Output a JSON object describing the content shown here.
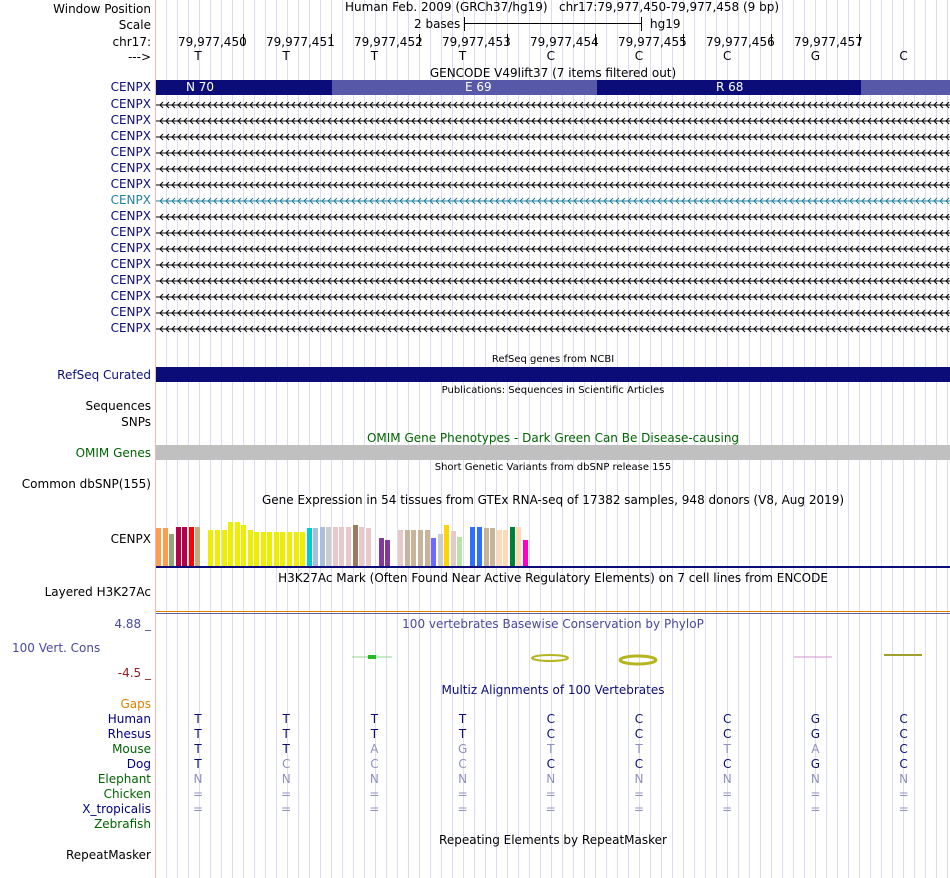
{
  "header": {
    "window_position_label": "Window Position",
    "scale_label": "Scale",
    "chrom_label": "chr17:",
    "strand_label": "--->",
    "assembly": "Human Feb. 2009 (GRCh37/hg19)",
    "position": "chr17:79,977,450-79,977,458 (9 bp)",
    "scale_text": "2 bases",
    "scale_db": "hg19"
  },
  "ruler": {
    "coords": [
      "79,977,450",
      "79,977,451",
      "79,977,452",
      "79,977,453",
      "79,977,454",
      "79,977,455",
      "79,977,456",
      "79,977,457"
    ],
    "bases": [
      "T",
      "T",
      "T",
      "T",
      "C",
      "C",
      "C",
      "G",
      "C"
    ]
  },
  "gencode": {
    "title": "GENCODE V49lift37 (7 items filtered out)",
    "label": "CENPX",
    "aa": [
      "N 70",
      "E 69",
      "R 68"
    ],
    "rows": [
      "CENPX",
      "CENPX",
      "CENPX",
      "CENPX",
      "CENPX",
      "CENPX",
      "CENPX",
      "CENPX",
      "CENPX",
      "CENPX",
      "CENPX",
      "CENPX",
      "CENPX",
      "CENPX",
      "CENPX"
    ],
    "highlight_row": 6
  },
  "refseq": {
    "title": "RefSeq genes from NCBI",
    "label": "RefSeq Curated"
  },
  "publications": {
    "title": "Publications: Sequences in Scientific Articles",
    "label1": "Sequences",
    "label2": "SNPs"
  },
  "omim": {
    "title": "OMIM Gene Phenotypes - Dark Green Can Be Disease-causing",
    "label": "OMIM Genes"
  },
  "dbsnp": {
    "title": "Short Genetic Variants from dbSNP release 155",
    "label": "Common dbSNP(155)"
  },
  "gtex": {
    "title": "Gene Expression in 54 tissues from GTEx RNA-seq of 17382 samples, 948 donors (V8, Aug 2019)",
    "label": "CENPX",
    "colors": [
      "#ff9d4e",
      "#ff9d4e",
      "#94a57a",
      "#b5004a",
      "#b5004a",
      "#ff0000",
      "#c7a97a",
      "#ffffff",
      "#eeee00",
      "#eeee00",
      "#eeee00",
      "#eeee00",
      "#eeee00",
      "#eeee00",
      "#eeee00",
      "#eeee00",
      "#eeee00",
      "#eeee00",
      "#eeee00",
      "#eeee00",
      "#eeee00",
      "#eeee00",
      "#eeee00",
      "#00cccc",
      "#a8c0dd",
      "#a8c0dd",
      "#cccccc",
      "#e8c8c8",
      "#e8c8c8",
      "#e8c8c8",
      "#9b7b5e",
      "#e8c8c8",
      "#e8c8c8",
      "#ffffff",
      "#7f3a9b",
      "#7f3a9b",
      "#ffffff",
      "#e8c8c8",
      "#c8b49a",
      "#c8b49a",
      "#c8b49a",
      "#c8b49a",
      "#6b6bff",
      "#cccccc",
      "#ffd400",
      "#e8c8c8",
      "#b8e3a6",
      "#ffffff",
      "#2f6fff",
      "#2f6fff",
      "#c8b49a",
      "#c8b49a",
      "#ffd9b3",
      "#ffd9b3",
      "#007f3a",
      "#ffd9b3",
      "#ff00cc"
    ],
    "values": [
      0.65,
      0.65,
      0.55,
      0.68,
      0.68,
      0.68,
      0.68,
      0.0,
      0.62,
      0.62,
      0.62,
      0.75,
      0.75,
      0.7,
      0.62,
      0.58,
      0.58,
      0.58,
      0.58,
      0.58,
      0.58,
      0.58,
      0.58,
      0.65,
      0.65,
      0.68,
      0.68,
      0.68,
      0.68,
      0.68,
      0.7,
      0.68,
      0.65,
      0.0,
      0.48,
      0.45,
      0.0,
      0.62,
      0.62,
      0.62,
      0.62,
      0.62,
      0.48,
      0.55,
      0.7,
      0.6,
      0.5,
      0.75,
      0.68,
      0.68,
      0.65,
      0.65,
      0.62,
      0.62,
      0.68,
      0.68,
      0.45
    ]
  },
  "h3k27ac": {
    "title": "H3K27Ac Mark (Often Found Near Active Regulatory Elements) on 7 cell lines from ENCODE",
    "label": "Layered H3K27Ac"
  },
  "phylop": {
    "title": "100 vertebrates Basewise Conservation by PhyloP",
    "label": "100 Vert. Cons",
    "max": "4.88 _",
    "min": "-4.5 _"
  },
  "multiz": {
    "title": "Multiz Alignments of 100 Vertebrates",
    "gaps_label": "Gaps",
    "species": [
      {
        "name": "Human",
        "color": "#000080",
        "bases": [
          "T",
          "T",
          "T",
          "T",
          "C",
          "C",
          "C",
          "G",
          "C"
        ],
        "dim": [
          false,
          false,
          false,
          false,
          false,
          false,
          false,
          false,
          false
        ]
      },
      {
        "name": "Rhesus",
        "color": "#000080",
        "bases": [
          "T",
          "T",
          "T",
          "T",
          "C",
          "C",
          "C",
          "G",
          "C"
        ],
        "dim": [
          false,
          false,
          false,
          false,
          false,
          false,
          false,
          false,
          false
        ]
      },
      {
        "name": "Mouse",
        "color": "#006400",
        "bases": [
          "T",
          "T",
          "A",
          "G",
          "T",
          "T",
          "T",
          "A",
          "C"
        ],
        "dim": [
          false,
          false,
          true,
          true,
          true,
          true,
          true,
          true,
          false
        ]
      },
      {
        "name": "Dog",
        "color": "#000080",
        "bases": [
          "T",
          "C",
          "C",
          "C",
          "C",
          "C",
          "C",
          "G",
          "C"
        ],
        "dim": [
          false,
          true,
          true,
          true,
          false,
          false,
          false,
          false,
          false
        ]
      },
      {
        "name": "Elephant",
        "color": "#006400",
        "bases": [
          "N",
          "N",
          "N",
          "N",
          "N",
          "N",
          "N",
          "N",
          "N"
        ],
        "dim": [
          true,
          true,
          true,
          true,
          true,
          true,
          true,
          true,
          true
        ]
      },
      {
        "name": "Chicken",
        "color": "#006400",
        "bases": [
          "=",
          "=",
          "=",
          "=",
          "=",
          "=",
          "=",
          "=",
          "="
        ],
        "dim": [
          true,
          true,
          true,
          true,
          true,
          true,
          true,
          true,
          true
        ]
      },
      {
        "name": "X_tropicalis",
        "color": "#000080",
        "bases": [
          "=",
          "=",
          "=",
          "=",
          "=",
          "=",
          "=",
          "=",
          "="
        ],
        "dim": [
          true,
          true,
          true,
          true,
          true,
          true,
          true,
          true,
          true
        ]
      },
      {
        "name": "Zebrafish",
        "color": "#006400",
        "bases": [
          "",
          "",
          "",
          "",
          "",
          "",
          "",
          "",
          ""
        ],
        "dim": [
          true,
          true,
          true,
          true,
          true,
          true,
          true,
          true,
          true
        ]
      }
    ]
  },
  "repeatmasker": {
    "title": "Repeating Elements by RepeatMasker",
    "label": "RepeatMasker"
  },
  "colors": {
    "dark_navy": "#0c0c78",
    "light_navy": "#5858a8",
    "label_navy": "#0c0c78",
    "omim_green": "#006400",
    "gap_orange": "#e08000",
    "phylop_blue": "#4848a0",
    "phylop_red": "#8b2020",
    "cenpx_highlight": "#1f7f9f"
  }
}
